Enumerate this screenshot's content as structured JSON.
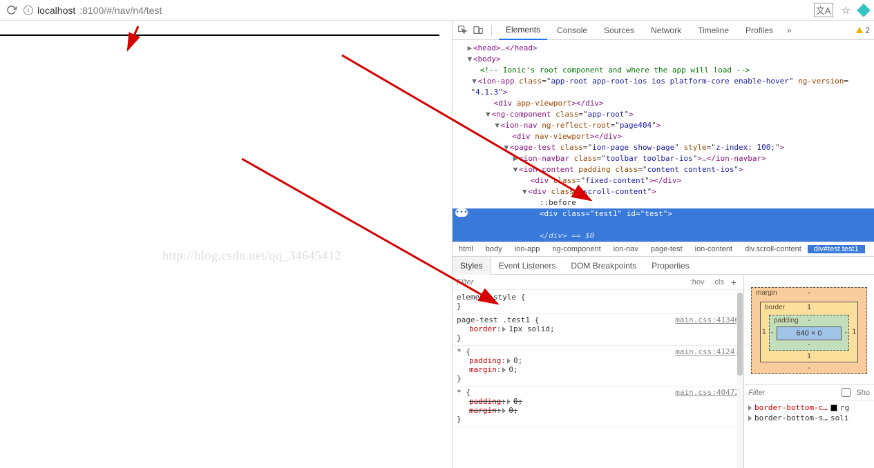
{
  "addressbar": {
    "host": "localhost",
    "port_path": ":8100/#/nav/n4/test"
  },
  "watermark": "http://blog.csdn.net/qq_34645412",
  "devtools": {
    "tabs": [
      "Elements",
      "Console",
      "Sources",
      "Network",
      "Timeline",
      "Profiles"
    ],
    "active_tab": "Elements",
    "warnings": "2",
    "dom": {
      "head": {
        "open": "<head>",
        "ell": "…",
        "close": "</head>"
      },
      "body_open": "<body>",
      "comment": "<!-- Ionic's root component and where the app will load -->",
      "ionapp": "<ion-app class=\"app-root app-root-ios ios platform-core enable-hover\" ng-version=\"4.1.3\">",
      "viewport": "<div app-viewport></div>",
      "ngcomp": "<ng-component class=\"app-root\">",
      "ionnav": "<ion-nav ng-reflect-root=\"page404\">",
      "navviewport": "<div nav-viewport></div>",
      "pagetest": "<page-test class=\"ion-page show-page\" style=\"z-index: 100;\">",
      "ionnavbar_open": "<ion-navbar class=\"toolbar toolbar-ios\">",
      "ionnavbar_ell": "…",
      "ionnavbar_close": "</ion-navbar>",
      "ioncontent": "<ion-content padding class=\"content content-ios\">",
      "fixed": "<div class=\"fixed-content\"></div>",
      "scroll": "<div class=\"scroll-content\">",
      "before": "::before",
      "selected": "<div class=\"test1\" id=\"test\">",
      "selected_close": "</div>",
      "eq": " == ",
      "dollar": "$0"
    },
    "breadcrumb": [
      "html",
      "body",
      "ion-app",
      "ng-component",
      "ion-nav",
      "page-test",
      "ion-content",
      "div.scroll-content",
      "div#test.test1"
    ],
    "side_tabs": [
      "Styles",
      "Event Listeners",
      "DOM Breakpoints",
      "Properties"
    ],
    "filter_placeholder": "Filter",
    "hov": ":hov",
    "cls": ".cls",
    "rules": {
      "element_style": "element.style {",
      "r1_sel": "page-test .test1 {",
      "r1_src": "main.css:41346",
      "r1_prop": "border",
      "r1_val": "1px solid",
      "r2_sel": "* {",
      "r2_src": "main.css:41247",
      "r2_p1": "padding",
      "r2_v1": "0",
      "r2_p2": "margin",
      "r2_v2": "0",
      "r3_sel": "* {",
      "r3_src": "main.css:40472",
      "r3_p1": "padding",
      "r3_v1": "0",
      "r3_p2": "margin",
      "r3_v2": "0"
    },
    "boxmodel": {
      "margin_label": "margin",
      "border_label": "border",
      "padding_label": "padding",
      "content": "640 × 0",
      "border_top": "1",
      "border_left": "1",
      "border_right": "1",
      "border_bottom": "1",
      "pad_top": "-",
      "pad_left": "-",
      "pad_right": "-",
      "pad_bot": "-",
      "margin_top": "-",
      "margin_left": "",
      "margin_right": "",
      "margin_bot": "-"
    },
    "computed_filter": "Filter",
    "computed_show": "Sho",
    "computed": {
      "p1": "border-bottom-c…",
      "v1": "rg",
      "p2": "border-bottom-s…",
      "v2": "soli"
    }
  }
}
